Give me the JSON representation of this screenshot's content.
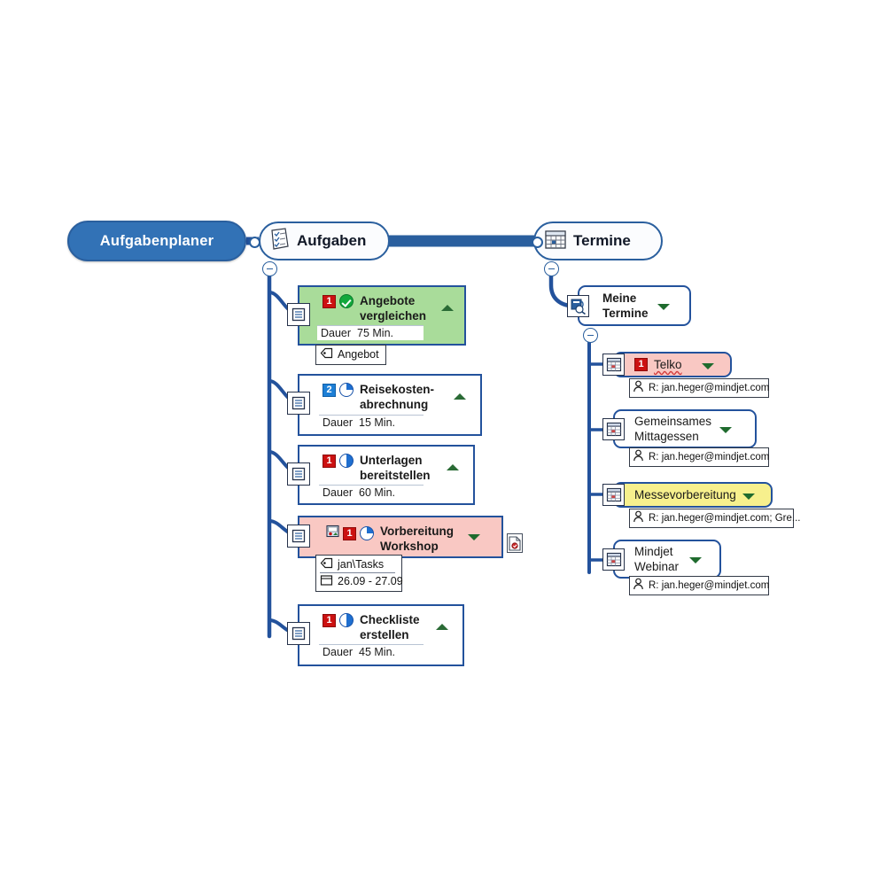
{
  "map": {
    "root": {
      "label": "Aufgabenplaner"
    },
    "branches": [
      {
        "label": "Aufgaben",
        "icon": "checklist-icon"
      },
      {
        "label": "Termine",
        "icon": "calendar-grid-icon"
      }
    ]
  },
  "tasks": {
    "collapse_label": "−",
    "items": [
      {
        "title": "Angebote vergleichen",
        "priority": "1",
        "priority_color": "#cc1111",
        "progress": "complete",
        "progress_icon": "green-check-icon",
        "fill": "#a9dc9a",
        "arrow": "up",
        "duration_label": "Dauer",
        "duration_value": "75 Min.",
        "tags": [
          {
            "icon": "tag-icon",
            "text": "Angebot"
          }
        ],
        "note_icon": "notes-icon"
      },
      {
        "title": "Reisekosten-abrechnung",
        "priority": "2",
        "priority_color": "#1d7fd6",
        "progress": "25",
        "progress_icon": "pie-25-icon",
        "fill": "#ffffff",
        "arrow": "up",
        "duration_label": "Dauer",
        "duration_value": "15 Min.",
        "tags": [],
        "note_icon": "notes-icon"
      },
      {
        "title": "Unterlagen bereitstellen",
        "priority": "1",
        "priority_color": "#cc1111",
        "progress": "50",
        "progress_icon": "pie-50-icon",
        "fill": "#ffffff",
        "arrow": "up",
        "duration_label": "Dauer",
        "duration_value": "60 Min.",
        "tags": [],
        "note_icon": "notes-icon"
      },
      {
        "title": "Vorbereitung Workshop",
        "priority": "1",
        "priority_color": "#cc1111",
        "progress": "25",
        "progress_icon": "pie-25-icon",
        "fill": "#f9c8c3",
        "arrow": "down",
        "duration_label": "",
        "duration_value": "",
        "tags": [
          {
            "icon": "tag-icon",
            "text": "jan\\Tasks"
          },
          {
            "icon": "calendar-small-icon",
            "text": "26.09 - 27.09"
          }
        ],
        "note_icon": "notes-icon",
        "extra_icon": "picture-attachment-icon",
        "attachment_icon": "document-attachment-icon"
      },
      {
        "title": "Checkliste erstellen",
        "priority": "1",
        "priority_color": "#cc1111",
        "progress": "50",
        "progress_icon": "pie-50-icon",
        "fill": "#ffffff",
        "arrow": "up",
        "duration_label": "Dauer",
        "duration_value": "45 Min.",
        "tags": [],
        "note_icon": "notes-icon"
      }
    ]
  },
  "appointments": {
    "parent": {
      "label_line1": "Meine",
      "label_line2": "Termine",
      "icon": "outlook-appointments-icon",
      "arrow": "down"
    },
    "items": [
      {
        "title": "Telko",
        "priority": "1",
        "fill": "#f9c8c3",
        "arrow": "down",
        "icon": "calendar-icon",
        "attendee_icon": "person-icon",
        "attendee": "R: jan.heger@mindjet.com"
      },
      {
        "title_line1": "Gemeinsames",
        "title_line2": "Mittagessen",
        "priority": "",
        "fill": "#ffffff",
        "arrow": "down",
        "icon": "calendar-icon",
        "attendee_icon": "person-icon",
        "attendee": "R: jan.heger@mindjet.com"
      },
      {
        "title": "Messevorbereitung",
        "priority": "",
        "fill": "#f7f08d",
        "arrow": "down",
        "icon": "calendar-icon",
        "attendee_icon": "person-icon",
        "attendee": "R: jan.heger@mindjet.com; Gre..."
      },
      {
        "title_line1": "Mindjet",
        "title_line2": "Webinar",
        "priority": "",
        "fill": "#ffffff",
        "arrow": "down",
        "icon": "calendar-icon",
        "attendee_icon": "person-icon",
        "attendee": "R: jan.heger@mindjet.com"
      }
    ]
  },
  "colors": {
    "root_fill": "#3272b6",
    "line": "#23529c",
    "border": "#2a5f9e",
    "green_fill": "#a9dc9a",
    "pink_fill": "#f9c8c3",
    "yellow_fill": "#f7f08d",
    "priority_red": "#cc1111",
    "priority_blue": "#1d7fd6"
  }
}
